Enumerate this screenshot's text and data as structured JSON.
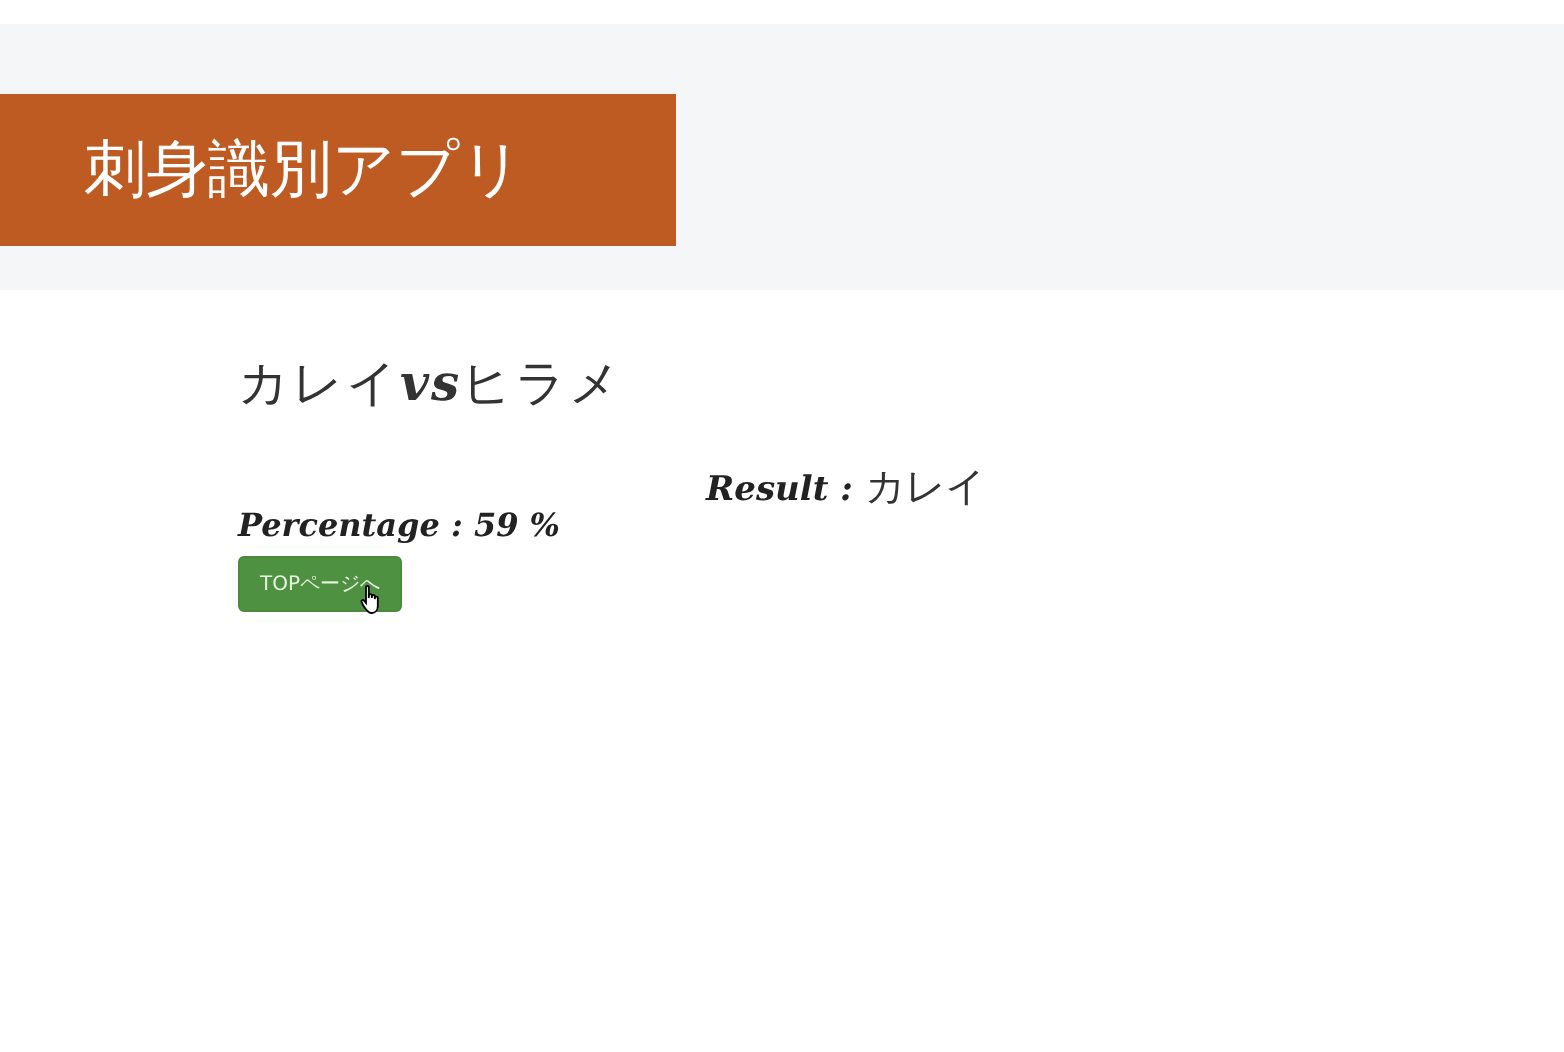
{
  "header": {
    "title": "刺身識別アプリ"
  },
  "comparison": {
    "title": "カレイ**vs**ヒラメ"
  },
  "result": {
    "label": "Result :",
    "value": "カレイ"
  },
  "percentage": {
    "text": "Percentage : 59 %"
  },
  "buttons": [
    {
      "label": "TOPページへ",
      "hovered": true
    }
  ]
}
